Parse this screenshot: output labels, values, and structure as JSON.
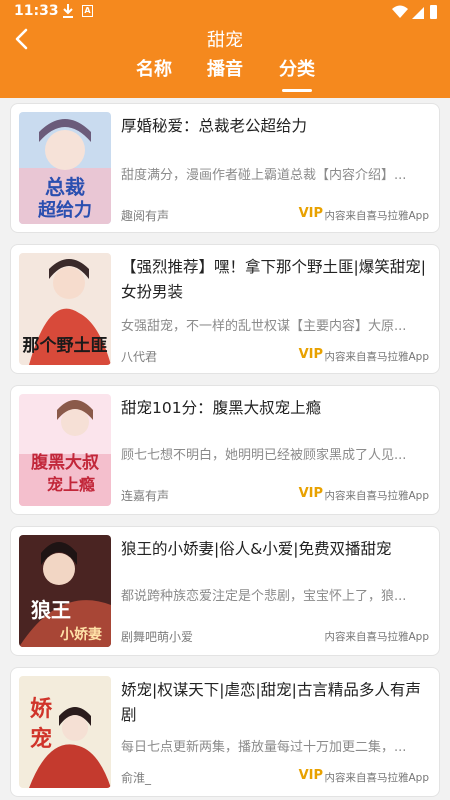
{
  "status": {
    "time": "11:33"
  },
  "header": {
    "title": "甜宠",
    "tabs": [
      "名称",
      "播音",
      "分类"
    ],
    "active_tab": 2
  },
  "items": [
    {
      "title": "厚婚秘爱：总裁老公超给力",
      "desc": "甜度满分，漫画作者碰上霸道总裁【内容介绍】...",
      "author": "趣阅有声",
      "vip": "VIP",
      "source": "内容来自喜马拉雅App",
      "cover_text": "总裁超给力",
      "cover_colors": [
        "#b9cfe8",
        "#e9c6d4"
      ]
    },
    {
      "title": "【强烈推荐】嘿！拿下那个野土匪|爆笑甜宠|女扮男装",
      "desc": "女强甜宠，不一样的乱世权谋【主要内容】大原...",
      "author": "八代君",
      "vip": "VIP",
      "source": "内容来自喜马拉雅App",
      "cover_text": "那个野土匪",
      "cover_colors": [
        "#f3e6dc",
        "#d94a3a"
      ]
    },
    {
      "title": "甜宠101分：腹黑大叔宠上瘾",
      "desc": "顾七七想不明白，她明明已经被顾家黑成了人见...",
      "author": "连嘉有声",
      "vip": "VIP",
      "source": "内容来自喜马拉雅App",
      "cover_text": "腹黑大叔宠上瘾",
      "cover_colors": [
        "#fbe3ea",
        "#f3b9c8"
      ]
    },
    {
      "title": "狼王的小娇妻|俗人&小爱|免费双播甜宠",
      "desc": "都说跨种族恋爱注定是个悲剧，宝宝怀上了，狼...",
      "author": "剧舞吧萌小爱",
      "vip": "",
      "source": "内容来自喜马拉雅App",
      "cover_text": "狼王小娇妻",
      "cover_colors": [
        "#5a2c2a",
        "#b24a3a"
      ]
    },
    {
      "title": "娇宠|权谋天下|虐恋|甜宠|古言精品多人有声剧",
      "desc": "每日七点更新两集，播放量每过十万加更二集，...",
      "author": "俞淮_",
      "vip": "VIP",
      "source": "内容来自喜马拉雅App",
      "cover_text": "娇宠",
      "cover_colors": [
        "#f1ead8",
        "#c23a2e"
      ]
    }
  ],
  "theme": {
    "accent": "#f5891e",
    "vip": "#e8a100"
  }
}
